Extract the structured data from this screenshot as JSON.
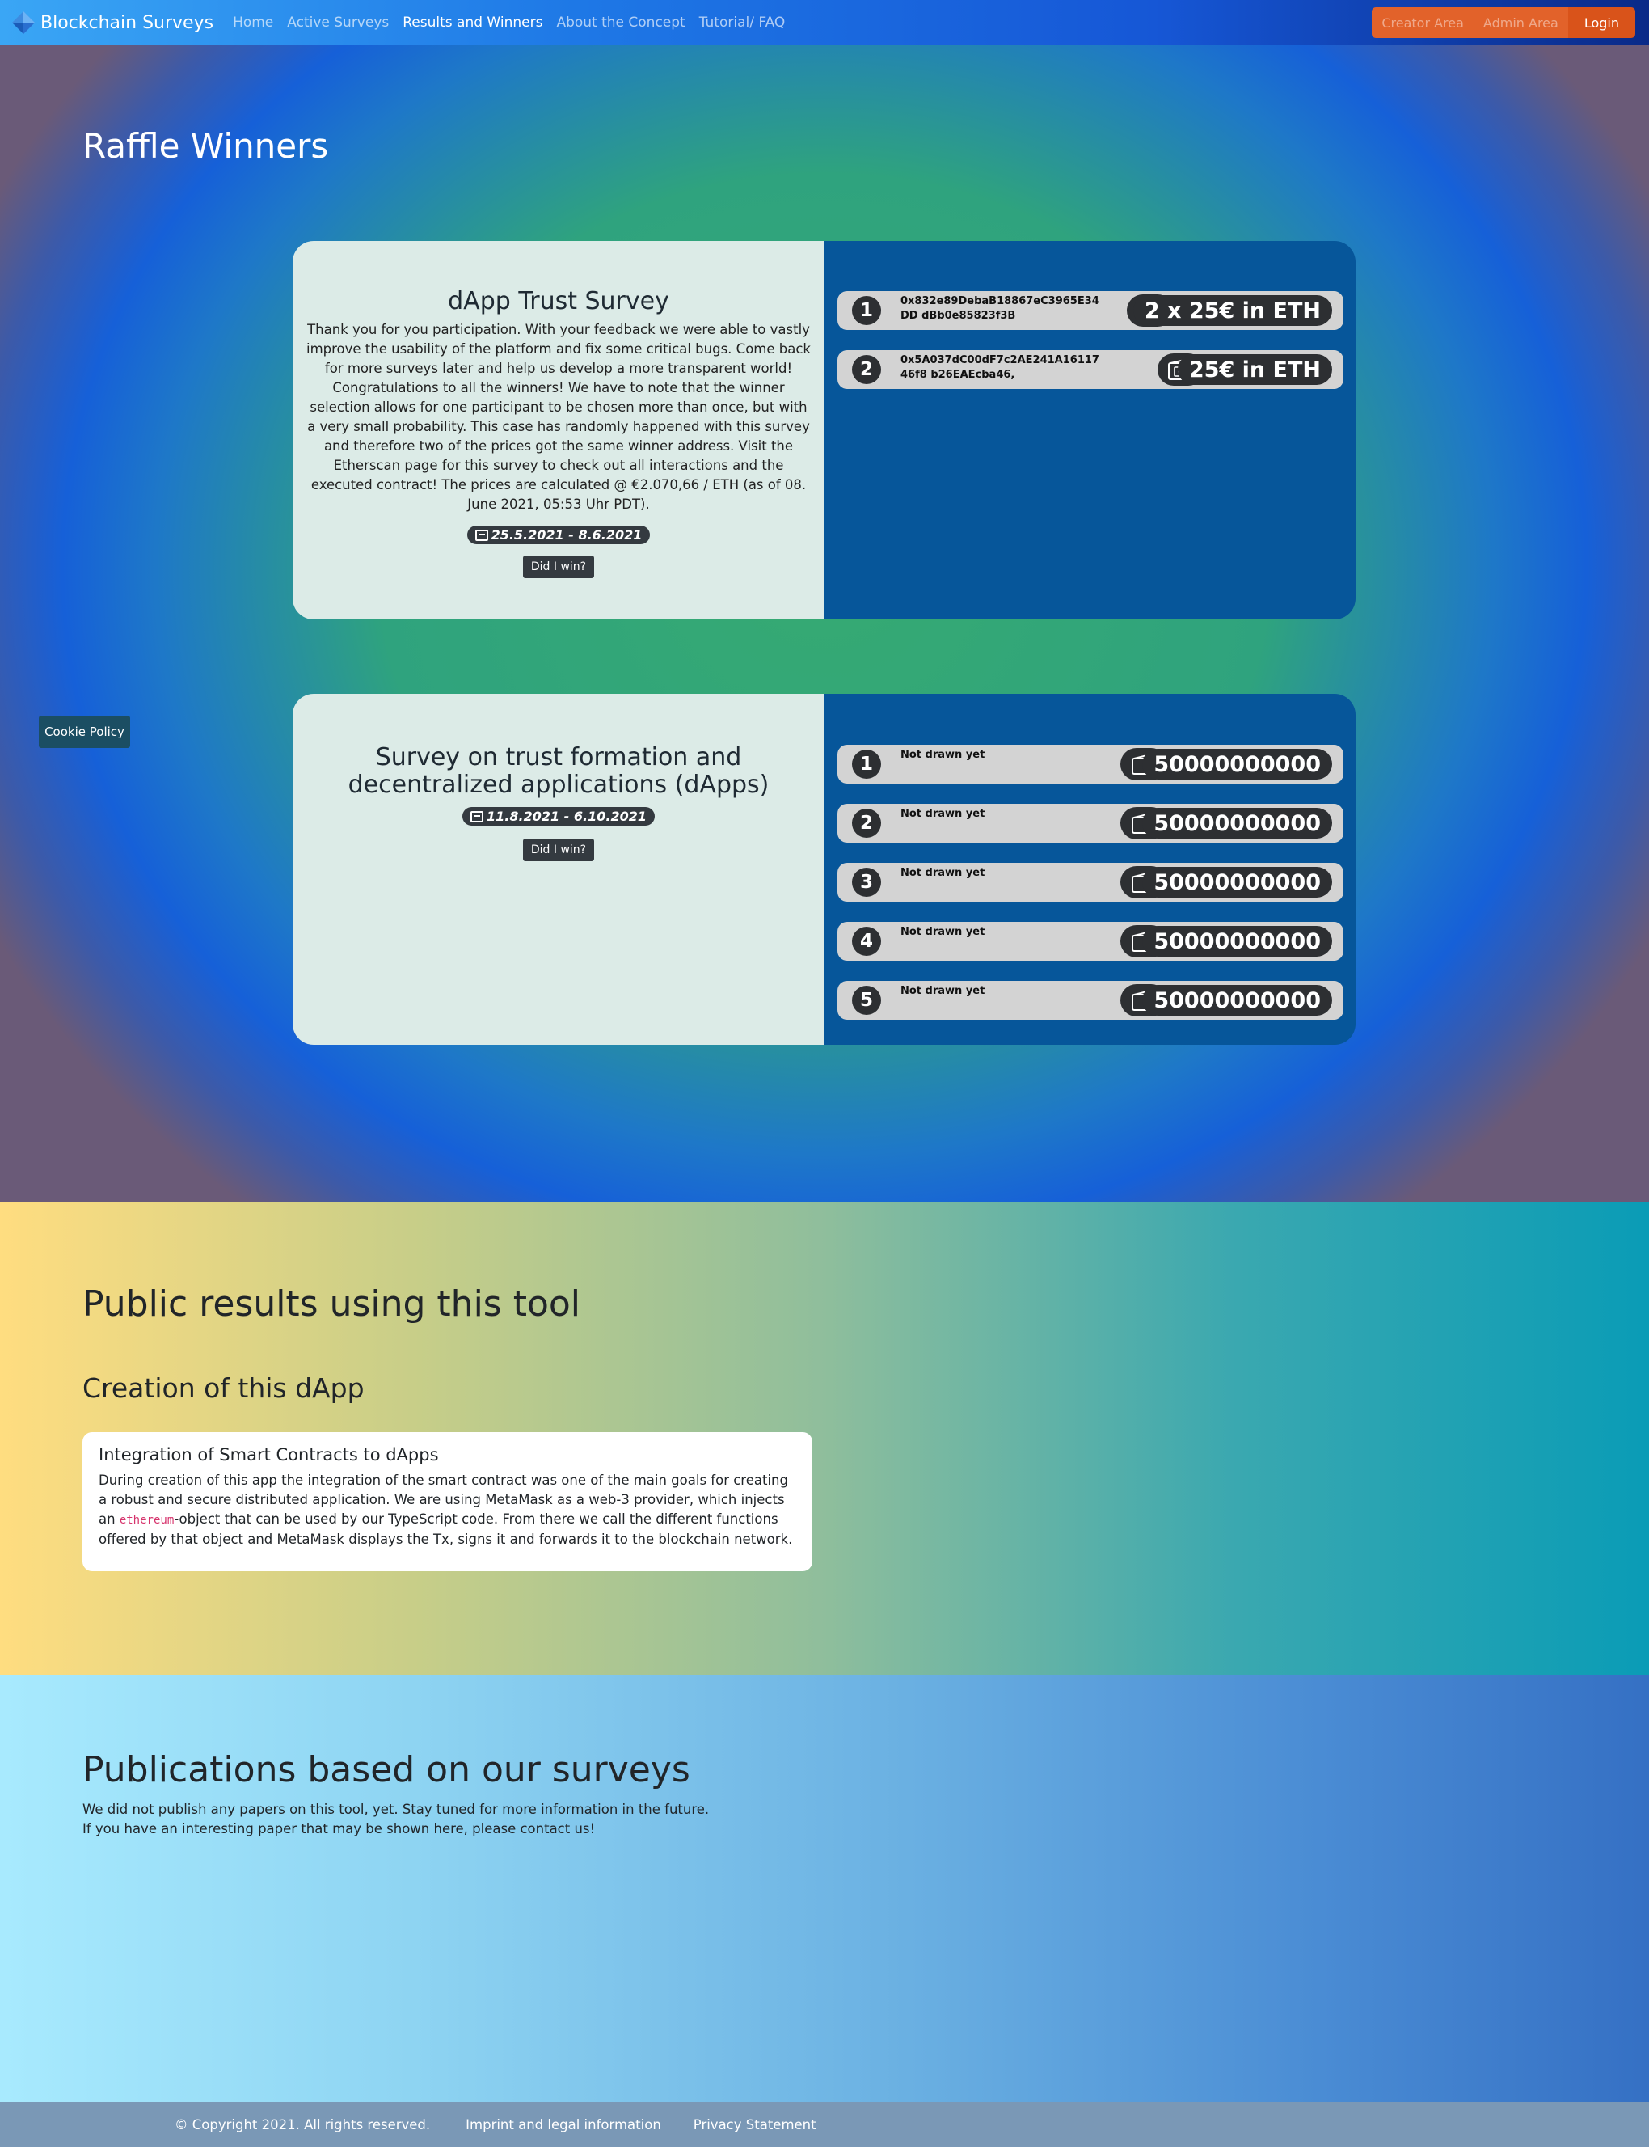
{
  "nav": {
    "brand": "Blockchain Surveys",
    "links": [
      "Home",
      "Active Surveys",
      "Results and Winners",
      "About the Concept",
      "Tutorial/ FAQ"
    ],
    "creator": "Creator Area",
    "admin": "Admin Area",
    "login": "Login"
  },
  "hero": {
    "title": "Raffle Winners"
  },
  "survey1": {
    "title": "dApp Trust Survey",
    "description": "Thank you for you participation. With your feedback we were able to vastly improve the usability of the platform and fix some critical bugs. Come back for more surveys later and help us develop a more transparent world! Congratulations to all the winners! We have to note that the winner selection allows for one participant to be chosen more than once, but with a very small probability. This case has randomly happened with this survey and therefore two of the prices got the same winner address. Visit the Etherscan page for this survey to check out all interactions and the executed contract! The prices are calculated @ €2.070,66 / ETH (as of 08. June 2021, 05:53 Uhr PDT).",
    "dates": "25.5.2021 - 8.6.2021",
    "button": "Did I win?",
    "prizes": [
      {
        "rank": "1",
        "winner": "0x832e89DebaB18867eC3965E34DD dBb0e85823f3B",
        "prize": "2 x 25€ in ETH"
      },
      {
        "rank": "2",
        "winner": "0x5A037dC00dF7c2AE241A1611746f8 b26EAEcba46,",
        "prize": "25€ in ETH"
      }
    ]
  },
  "survey2": {
    "title": "Survey on trust formation and decentralized applications (dApps)",
    "dates": "11.8.2021 - 6.10.2021",
    "button": "Did I win?",
    "prizes": [
      {
        "rank": "1",
        "winner": "Not drawn yet",
        "prize": "50000000000"
      },
      {
        "rank": "2",
        "winner": "Not drawn yet",
        "prize": "50000000000"
      },
      {
        "rank": "3",
        "winner": "Not drawn yet",
        "prize": "50000000000"
      },
      {
        "rank": "4",
        "winner": "Not drawn yet",
        "prize": "50000000000"
      },
      {
        "rank": "5",
        "winner": "Not drawn yet",
        "prize": "50000000000"
      }
    ]
  },
  "cookie": "Cookie Policy",
  "public": {
    "title": "Public results using this tool",
    "subtitle": "Creation of this dApp",
    "card_title": "Integration of Smart Contracts to dApps",
    "card_text_1": "During creation of this app the integration of the smart contract was one of the main goals for creating a robust and secure distributed application. We are using MetaMask as a web-3 provider, which injects an ",
    "card_code": "ethereum",
    "card_text_2": "-object that can be used by our TypeScript code. From there we call the different functions offered by that object and MetaMask displays the Tx, signs it and forwards it to the blockchain network."
  },
  "pubs": {
    "title": "Publications based on our surveys",
    "line1": "We did not publish any papers on this tool, yet. Stay tuned for more information in the future.",
    "line2": "If you have an interesting paper that may be shown here, please contact us!"
  },
  "footer": {
    "copyright": "© Copyright 2021. All rights reserved.",
    "imprint": "Imprint and legal information",
    "privacy": "Privacy Statement"
  },
  "icons": {
    "brand": "ethereum-diamond-icon",
    "calendar": "calendar-icon",
    "wallet_full": "wallet-cash-icon",
    "wallet_empty": "wallet-icon"
  }
}
